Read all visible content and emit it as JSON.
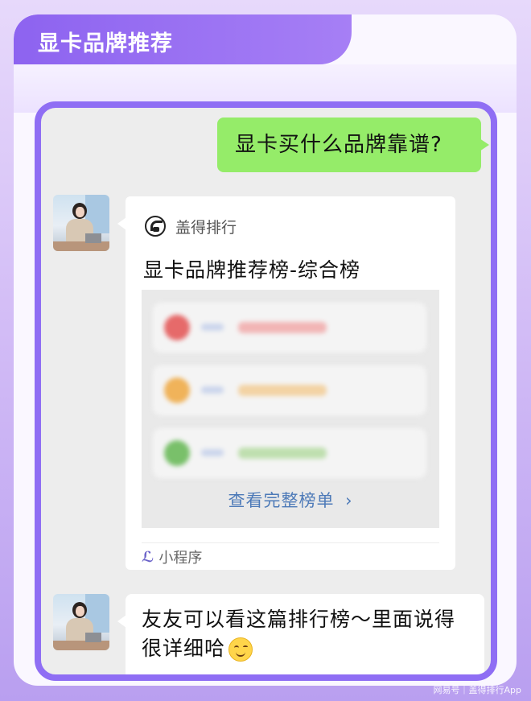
{
  "header": {
    "title": "显卡品牌推荐"
  },
  "chat": {
    "my_message": "显卡买什么品牌靠谱?",
    "card": {
      "source_name": "盖得排行",
      "title": "显卡品牌推荐榜-综合榜",
      "rank_rows": [
        {
          "color": "#e66a6a",
          "bar_color": "#f2b5b5"
        },
        {
          "color": "#f0b35a",
          "bar_color": "#f3d3a4"
        },
        {
          "color": "#79c06a",
          "bar_color": "#bfdfaf"
        }
      ],
      "view_more_label": "查看完整榜单",
      "view_more_icon": "chevron-right-icon",
      "mini_program_icon": "mini-program-icon",
      "mini_program_label": "小程序"
    },
    "friend_message": "友友可以看这篇排行榜～里面说得很详细哈",
    "friend_emoji": "smile-icon"
  },
  "watermark": "网易号｜盖得排行App",
  "colors": {
    "accent": "#8f6ef4",
    "my_bubble": "#95ec69",
    "link": "#4d7ab8"
  }
}
